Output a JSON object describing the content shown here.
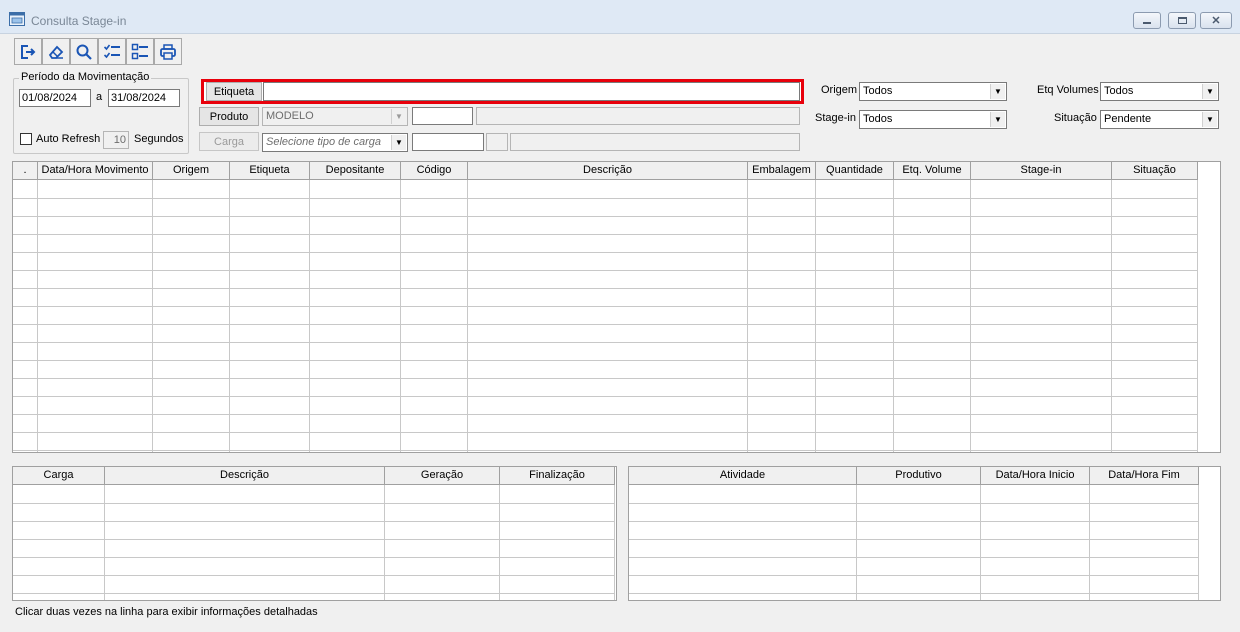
{
  "window": {
    "title": "Consulta Stage-in",
    "controls": [
      "minimize-icon",
      "maximize-icon",
      "close-icon"
    ]
  },
  "toolbar": {
    "buttons": [
      "exit-icon",
      "eraser-icon",
      "search-icon",
      "checklist-icon",
      "uncheck-list-icon",
      "print-icon"
    ]
  },
  "periodo": {
    "label": "Período da Movimentação",
    "date_from": "01/08/2024",
    "separator": "a",
    "date_to": "31/08/2024",
    "auto_refresh_label": "Auto Refresh",
    "auto_refresh_checked": false,
    "refresh_seconds": "10",
    "seconds_label": "Segundos"
  },
  "filters": {
    "etiqueta_button": "Etiqueta",
    "etiqueta_value": "",
    "produto_button": "Produto",
    "produto_value": "MODELO",
    "produto_code": "",
    "produto_desc": "",
    "carga_button": "Carga",
    "carga_placeholder": "Selecione tipo de carga",
    "carga_code": "",
    "carga_desc": "",
    "origem_label": "Origem",
    "origem_value": "Todos",
    "stagein_label": "Stage-in",
    "stagein_value": "Todos",
    "etqvolumes_label": "Etq Volumes",
    "etqvolumes_value": "Todos",
    "situacao_label": "Situação",
    "situacao_value": "Pendente"
  },
  "main_grid": {
    "columns": [
      ".",
      "Data/Hora Movimento",
      "Origem",
      "Etiqueta",
      "Depositante",
      "Código",
      "Descrição",
      "Embalagem",
      "Quantidade",
      "Etq. Volume",
      "Stage-in",
      "Situação"
    ],
    "rows": []
  },
  "carga_grid": {
    "columns": [
      "Carga",
      "Descrição",
      "Geração",
      "Finalização"
    ],
    "rows": []
  },
  "atividade_grid": {
    "columns": [
      "Atividade",
      "Produtivo",
      "Data/Hora Inicio",
      "Data/Hora Fim"
    ],
    "rows": []
  },
  "status": {
    "hint": "Clicar duas vezes na linha para exibir informações detalhadas"
  },
  "colors": {
    "highlight": "#e8000b",
    "titlebar": "#dfe9f5"
  }
}
